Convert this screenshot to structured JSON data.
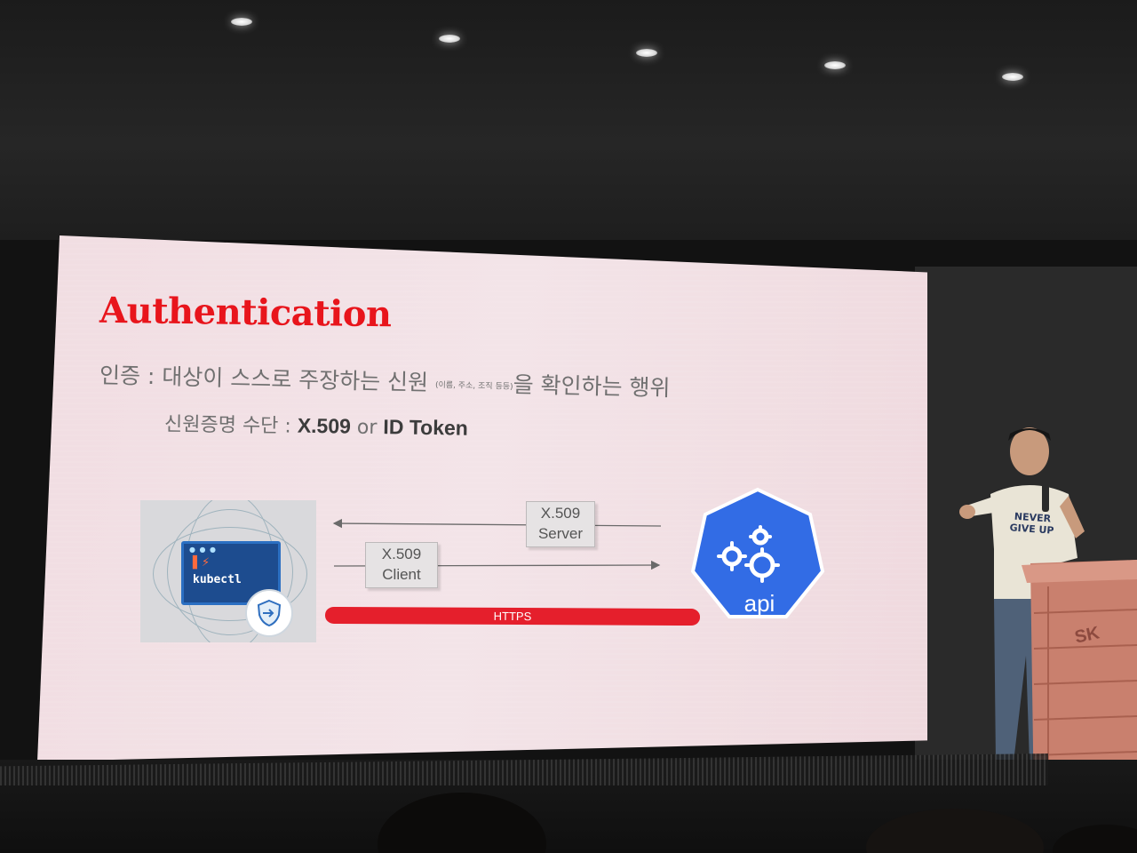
{
  "slide": {
    "title": "Authentication",
    "definition_prefix": "인증 : 대상이 스스로 주장하는 신원",
    "definition_small": "(이름, 주소, 조직 등등)",
    "definition_suffix": "을 확인하는 행위",
    "credential_label": "신원증명 수단 : ",
    "credential_x509": "X.509",
    "credential_or": " or ",
    "credential_token": "ID Token"
  },
  "diagram": {
    "client_tool": "kubectl",
    "server_note_line1": "X.509",
    "server_note_line2": "Server",
    "client_note_line1": "X.509",
    "client_note_line2": "Client",
    "transport": "HTTPS",
    "server_label": "api",
    "colors": {
      "title_red": "#e8151c",
      "https_red": "#e51f2c",
      "k8s_blue": "#326ce5",
      "terminal_blue": "#1d4c8f"
    }
  },
  "scene": {
    "shirt_line1": "NEVER",
    "shirt_line2": "GIVE UP",
    "podium_logo": "SK"
  }
}
